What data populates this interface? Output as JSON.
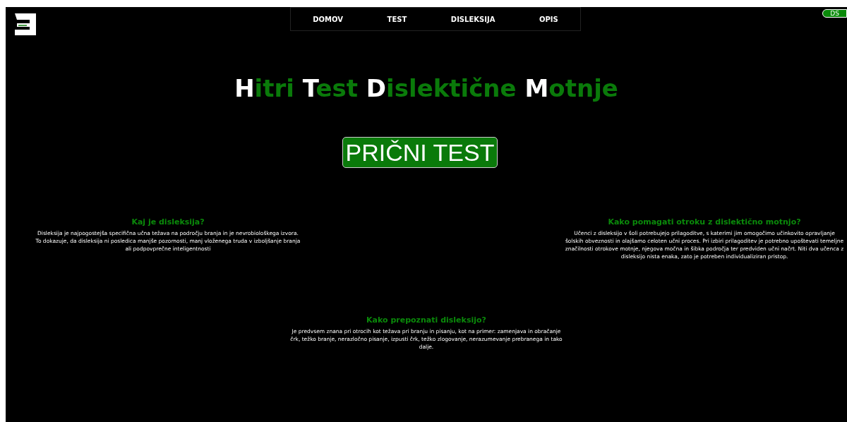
{
  "nav": [
    {
      "label": "DOMOV"
    },
    {
      "label": "TEST"
    },
    {
      "label": "DISLEKSIJA"
    },
    {
      "label": "OPIS"
    }
  ],
  "badge": "DS",
  "title": "Hitri Test Dislektične Motnje",
  "start_button": "PRIČNI TEST",
  "sections": [
    {
      "heading": "Kaj je disleksija?",
      "text": "Disleksija je najpogostejša specifična učna težava na področju branja in je nevrobiološkega izvora. To dokazuje, da disleksija ni posledica manjše pozornosti, manj vloženega truda v izboljšanje branja ali podpovprečne inteligentnosti"
    },
    {
      "heading": "Kako pomagati otroku z dislektično motnjo?",
      "text": "Učenci z disleksijo v šoli potrebujejo prilagoditve, s katerimi jim omogočimo učinkovito opravljanje šolskih obveznosti in olajšamo celoten učni proces. Pri izbiri prilagoditev je potrebno upoštevati temeljne značilnosti otrokove motnje, njegova močna in šibka področja ter predviden učni načrt. Niti dva učenca z disleksijo nista enaka, zato je potreben individualiziran pristop."
    },
    {
      "heading": "Kako prepoznati disleksijo?",
      "text": "Je predvsem znana pri otrocih kot težava pri branju in pisanju, kot na primer: zamenjava in obračanje črk, težko branje, nerazločno pisanje, izpusti črk, težko zlogovanje, nerazumevanje prebranega in tako dalje."
    }
  ]
}
